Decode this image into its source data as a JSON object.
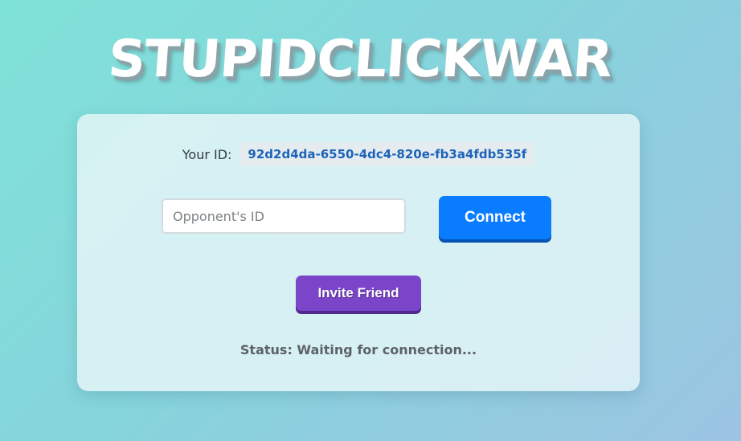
{
  "app": {
    "title": "STUPIDCLICKWAR"
  },
  "identity": {
    "label": "Your ID:",
    "value": "92d2d4da-6550-4dc4-820e-fb3a4fdb535f"
  },
  "opponent": {
    "placeholder": "Opponent's ID",
    "value": ""
  },
  "actions": {
    "connect_label": "Connect",
    "invite_label": "Invite Friend"
  },
  "status": {
    "text": "Status: Waiting for connection..."
  },
  "colors": {
    "connect": "#0a7cff",
    "invite": "#7a45c9",
    "id_text": "#1e63b8"
  }
}
